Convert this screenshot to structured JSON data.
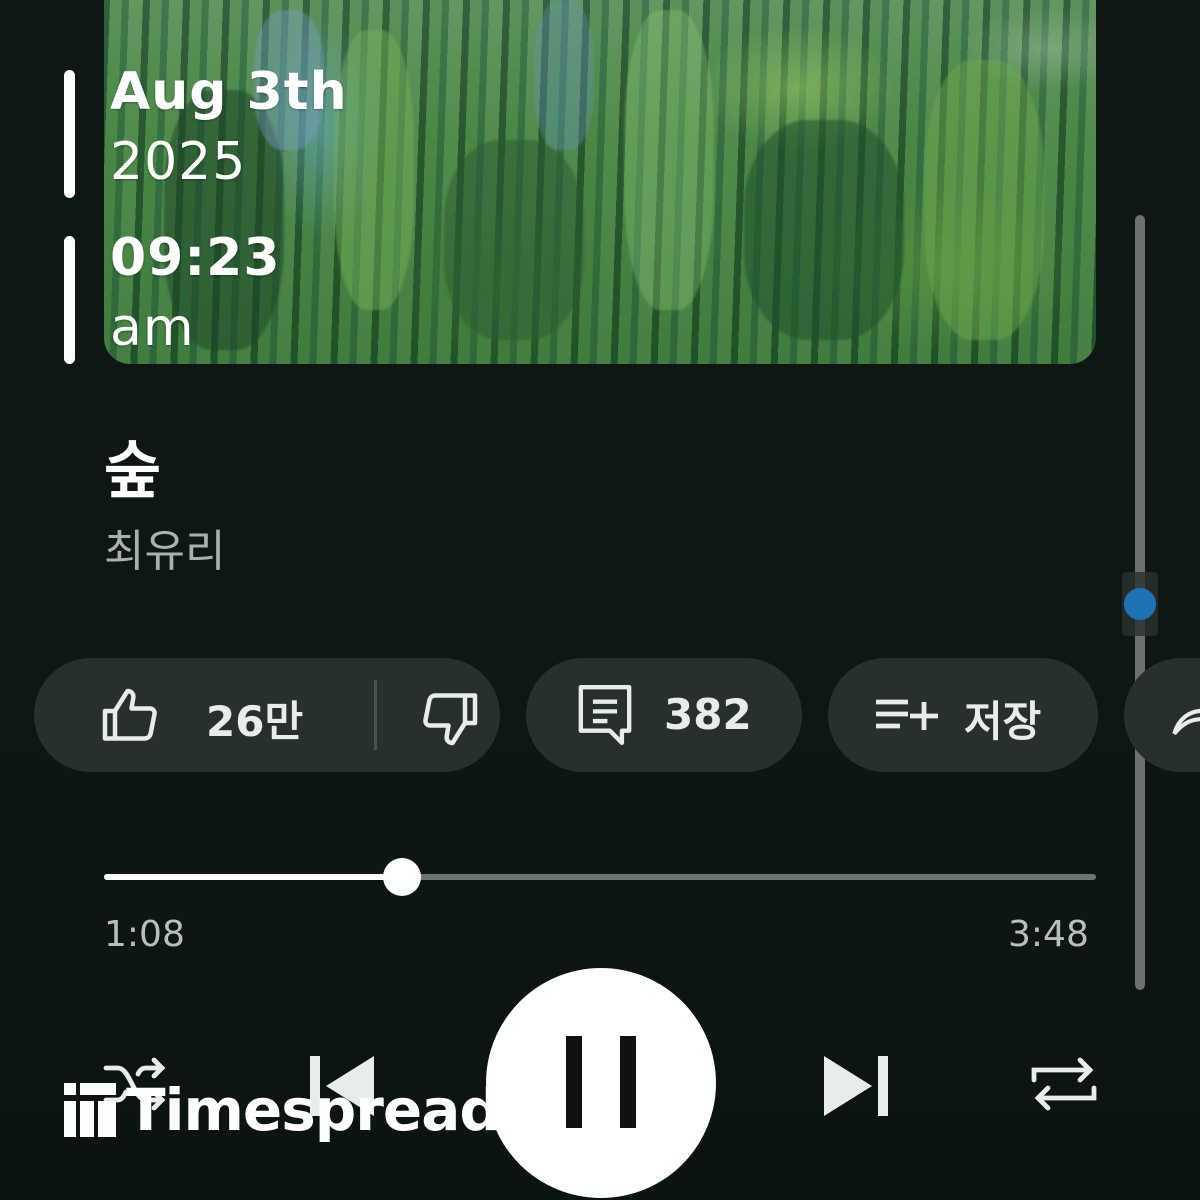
{
  "overlay": {
    "date": "Aug 3th",
    "year": "2025",
    "time": "09:23",
    "meridiem": "am"
  },
  "track": {
    "title": "숲",
    "artist": "최유리"
  },
  "actions": {
    "likes": "26만",
    "comments": "382",
    "save_label": "저장"
  },
  "playback": {
    "elapsed": "1:08",
    "duration": "3:48",
    "progress_fraction": 0.3,
    "state": "playing"
  },
  "watermark": {
    "brand": "Timespread"
  },
  "colors": {
    "background": "#0e1714",
    "pill": "#27302c",
    "scroll_indicator": "#1e73b4"
  },
  "icons": {
    "like": "thumbs-up-icon",
    "dislike": "thumbs-down-icon",
    "comment": "comment-icon",
    "save": "playlist-add-icon",
    "share": "share-icon",
    "shuffle": "shuffle-icon",
    "previous": "skip-previous-icon",
    "pause": "pause-icon",
    "next": "skip-next-icon",
    "repeat": "repeat-icon"
  }
}
